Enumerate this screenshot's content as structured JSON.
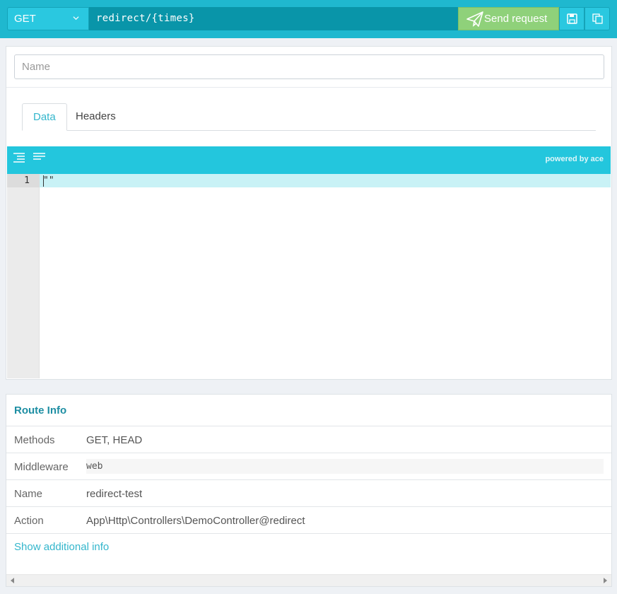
{
  "request": {
    "method": "GET",
    "url": "redirect/{times}",
    "send_label": "Send request",
    "name_placeholder": "Name"
  },
  "tabs": [
    {
      "label": "Data",
      "active": true
    },
    {
      "label": "Headers",
      "active": false
    }
  ],
  "editor": {
    "powered_by": "powered by ace",
    "line_number": "1",
    "content": "\"\""
  },
  "route_info": {
    "title": "Route Info",
    "rows": [
      {
        "key": "Methods",
        "value": "GET, HEAD"
      },
      {
        "key": "Middleware",
        "value": "web"
      },
      {
        "key": "Name",
        "value": "redirect-test"
      },
      {
        "key": "Action",
        "value": "App\\Http\\Controllers\\DemoController@redirect"
      }
    ],
    "more_link": "Show additional info"
  },
  "colors": {
    "accent": "#1fb8cf",
    "send": "#8fd17a",
    "link": "#33b6cc"
  },
  "icons": [
    "chevron-down-icon",
    "paper-plane-icon",
    "save-icon",
    "copy-icon",
    "format-icon",
    "compact-icon"
  ]
}
